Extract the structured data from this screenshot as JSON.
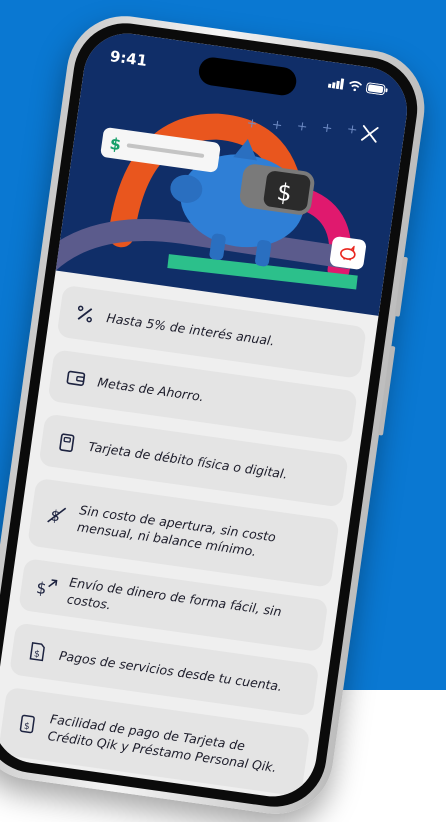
{
  "status_bar": {
    "time": "9:41"
  },
  "header": {
    "currency_symbol": "$",
    "close_icon": "close-icon"
  },
  "colors": {
    "background": "#0a78d2",
    "header": "#102e68",
    "feature_card": "#e4e4e4",
    "accent_green": "#15a06a",
    "accent_orange": "#e9561e",
    "accent_pink": "#e0196e"
  },
  "features": [
    {
      "icon": "percent-icon",
      "text": "Hasta 5% de interés anual."
    },
    {
      "icon": "wallet-icon",
      "text": "Metas de Ahorro."
    },
    {
      "icon": "card-icon",
      "text": "Tarjeta de débito física o digital."
    },
    {
      "icon": "no-fee-icon",
      "text": "Sin costo de apertura, sin costo mensual, ni balance mínimo."
    },
    {
      "icon": "money-send-icon",
      "text": "Envío de dinero de forma fácil, sin costos."
    },
    {
      "icon": "bill-pay-icon",
      "text": "Pagos de servicios desde tu cuenta."
    },
    {
      "icon": "credit-pay-icon",
      "text": "Facilidad de pago de Tarjeta de Crédito Qik y Préstamo Personal Qik."
    }
  ]
}
